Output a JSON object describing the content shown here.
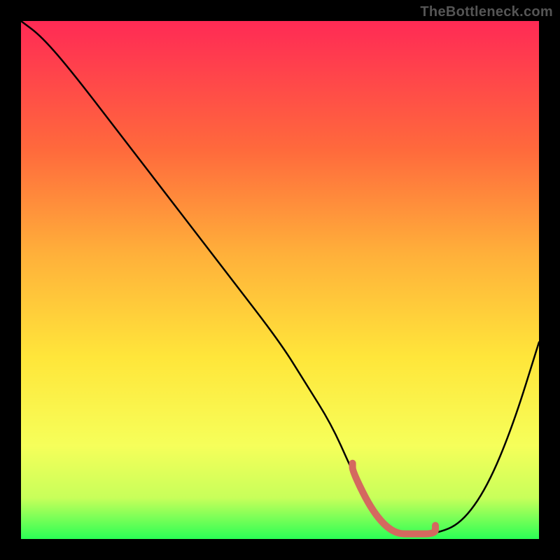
{
  "watermark": "TheBottleneck.com",
  "chart_data": {
    "type": "line",
    "title": "",
    "xlabel": "",
    "ylabel": "",
    "xlim": [
      0,
      100
    ],
    "ylim": [
      0,
      100
    ],
    "x": [
      0,
      4,
      10,
      20,
      30,
      40,
      50,
      55,
      60,
      64,
      68,
      72,
      76,
      80,
      85,
      90,
      95,
      100
    ],
    "values": [
      100,
      97,
      90,
      77,
      64,
      51,
      38,
      30,
      22,
      13,
      5,
      1,
      1,
      1,
      3,
      10,
      22,
      38
    ],
    "highlight_region": {
      "x0": 63,
      "x1": 80,
      "y": 1
    },
    "gradient_stops": [
      {
        "offset": 0.0,
        "color": "#ff2a55"
      },
      {
        "offset": 0.25,
        "color": "#ff6a3c"
      },
      {
        "offset": 0.45,
        "color": "#ffb03a"
      },
      {
        "offset": 0.65,
        "color": "#ffe63a"
      },
      {
        "offset": 0.82,
        "color": "#f6ff5a"
      },
      {
        "offset": 0.92,
        "color": "#c8ff5a"
      },
      {
        "offset": 1.0,
        "color": "#2aff55"
      }
    ]
  }
}
